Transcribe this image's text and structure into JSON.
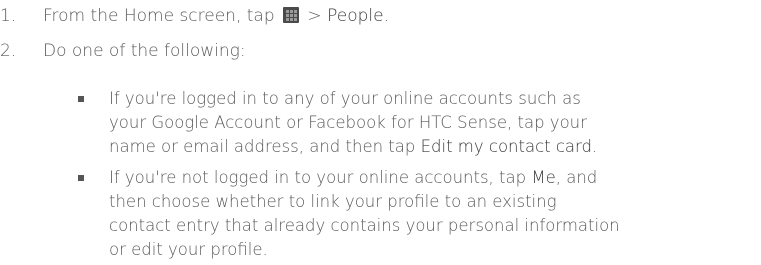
{
  "steps": [
    {
      "number": "1.",
      "text_before_icon": "From the Home screen, tap",
      "icon": "apps-grid-icon",
      "text_after_icon": " > ",
      "emphasis": "People",
      "text_end": "."
    },
    {
      "number": "2.",
      "text": "Do one of the following:"
    }
  ],
  "bullets": [
    {
      "lines": [
        "If you're logged in to any of your online accounts such as",
        "your Google Account or Facebook for HTC Sense, tap your",
        "name or email address, and then tap "
      ],
      "emphasis": "Edit my contact card",
      "text_end": "."
    },
    {
      "line1_before": "If you're not logged in to your online accounts, tap ",
      "emphasis": "Me",
      "line1_after": ", and",
      "lines": [
        "then choose whether to link your profile to an existing",
        "contact entry that already contains your personal information",
        "or edit your profile."
      ]
    }
  ]
}
